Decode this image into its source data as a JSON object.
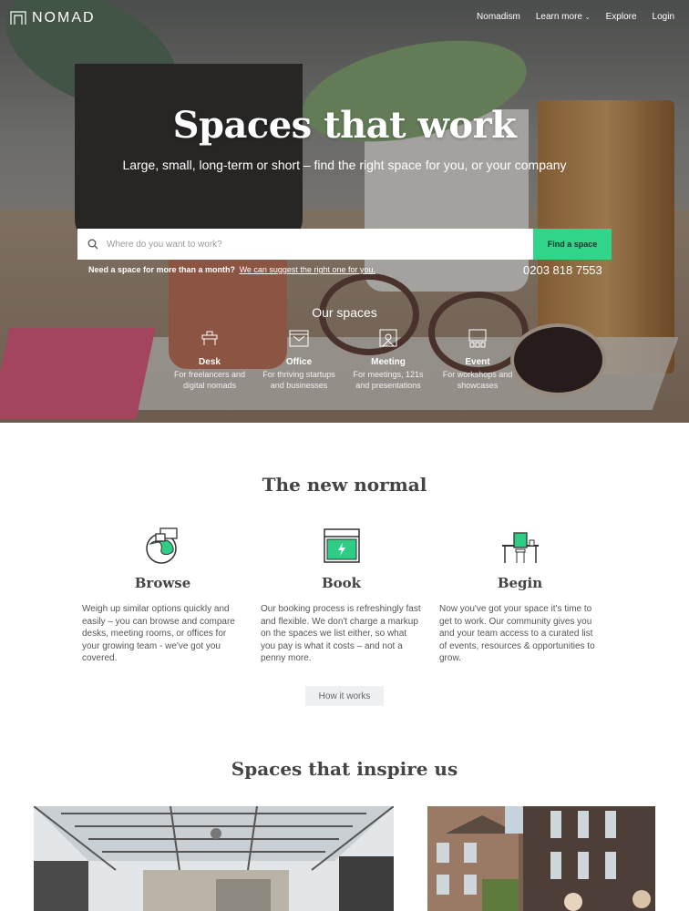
{
  "nav": {
    "logo_text": "NOMAD",
    "links": [
      "Nomadism",
      "Learn more",
      "Explore",
      "Login"
    ]
  },
  "hero": {
    "title": "Spaces that work",
    "subtitle": "Large, small, long-term or short – find the right space for you, or your company",
    "search_placeholder": "Where do you want to work?",
    "search_button": "Find a space",
    "more_question": "Need a space for more than a month?",
    "more_link": "We can suggest the right one for you.",
    "phone": "0203 818 7553",
    "our_spaces_label": "Our spaces",
    "space_types": [
      {
        "name": "Desk",
        "desc1": "For freelancers and",
        "desc2": "digital nomads"
      },
      {
        "name": "Office",
        "desc1": "For thriving startups",
        "desc2": "and businesses"
      },
      {
        "name": "Meeting",
        "desc1": "For meetings, 121s",
        "desc2": "and presentations"
      },
      {
        "name": "Event",
        "desc1": "For workshops and",
        "desc2": "showcases"
      }
    ]
  },
  "new_normal": {
    "title": "The new normal",
    "features": [
      {
        "title": "Browse",
        "text": "Weigh up similar options quickly and easily – you can browse and compare desks, meeting rooms, or offices for your growing team - we've got you covered."
      },
      {
        "title": "Book",
        "text": "Our booking process is refreshingly fast and flexible. We don't charge a markup on the spaces we list either, so what you pay is what it costs – and not a penny more."
      },
      {
        "title": "Begin",
        "text": "Now you've got your space it's time to get to work. Our community gives you and your team access to a curated list of events, resources & opportunities to grow."
      }
    ],
    "how_button": "How it works"
  },
  "inspire": {
    "title": "Spaces that inspire us"
  },
  "colors": {
    "accent": "#31d58a",
    "heading": "#444444"
  }
}
